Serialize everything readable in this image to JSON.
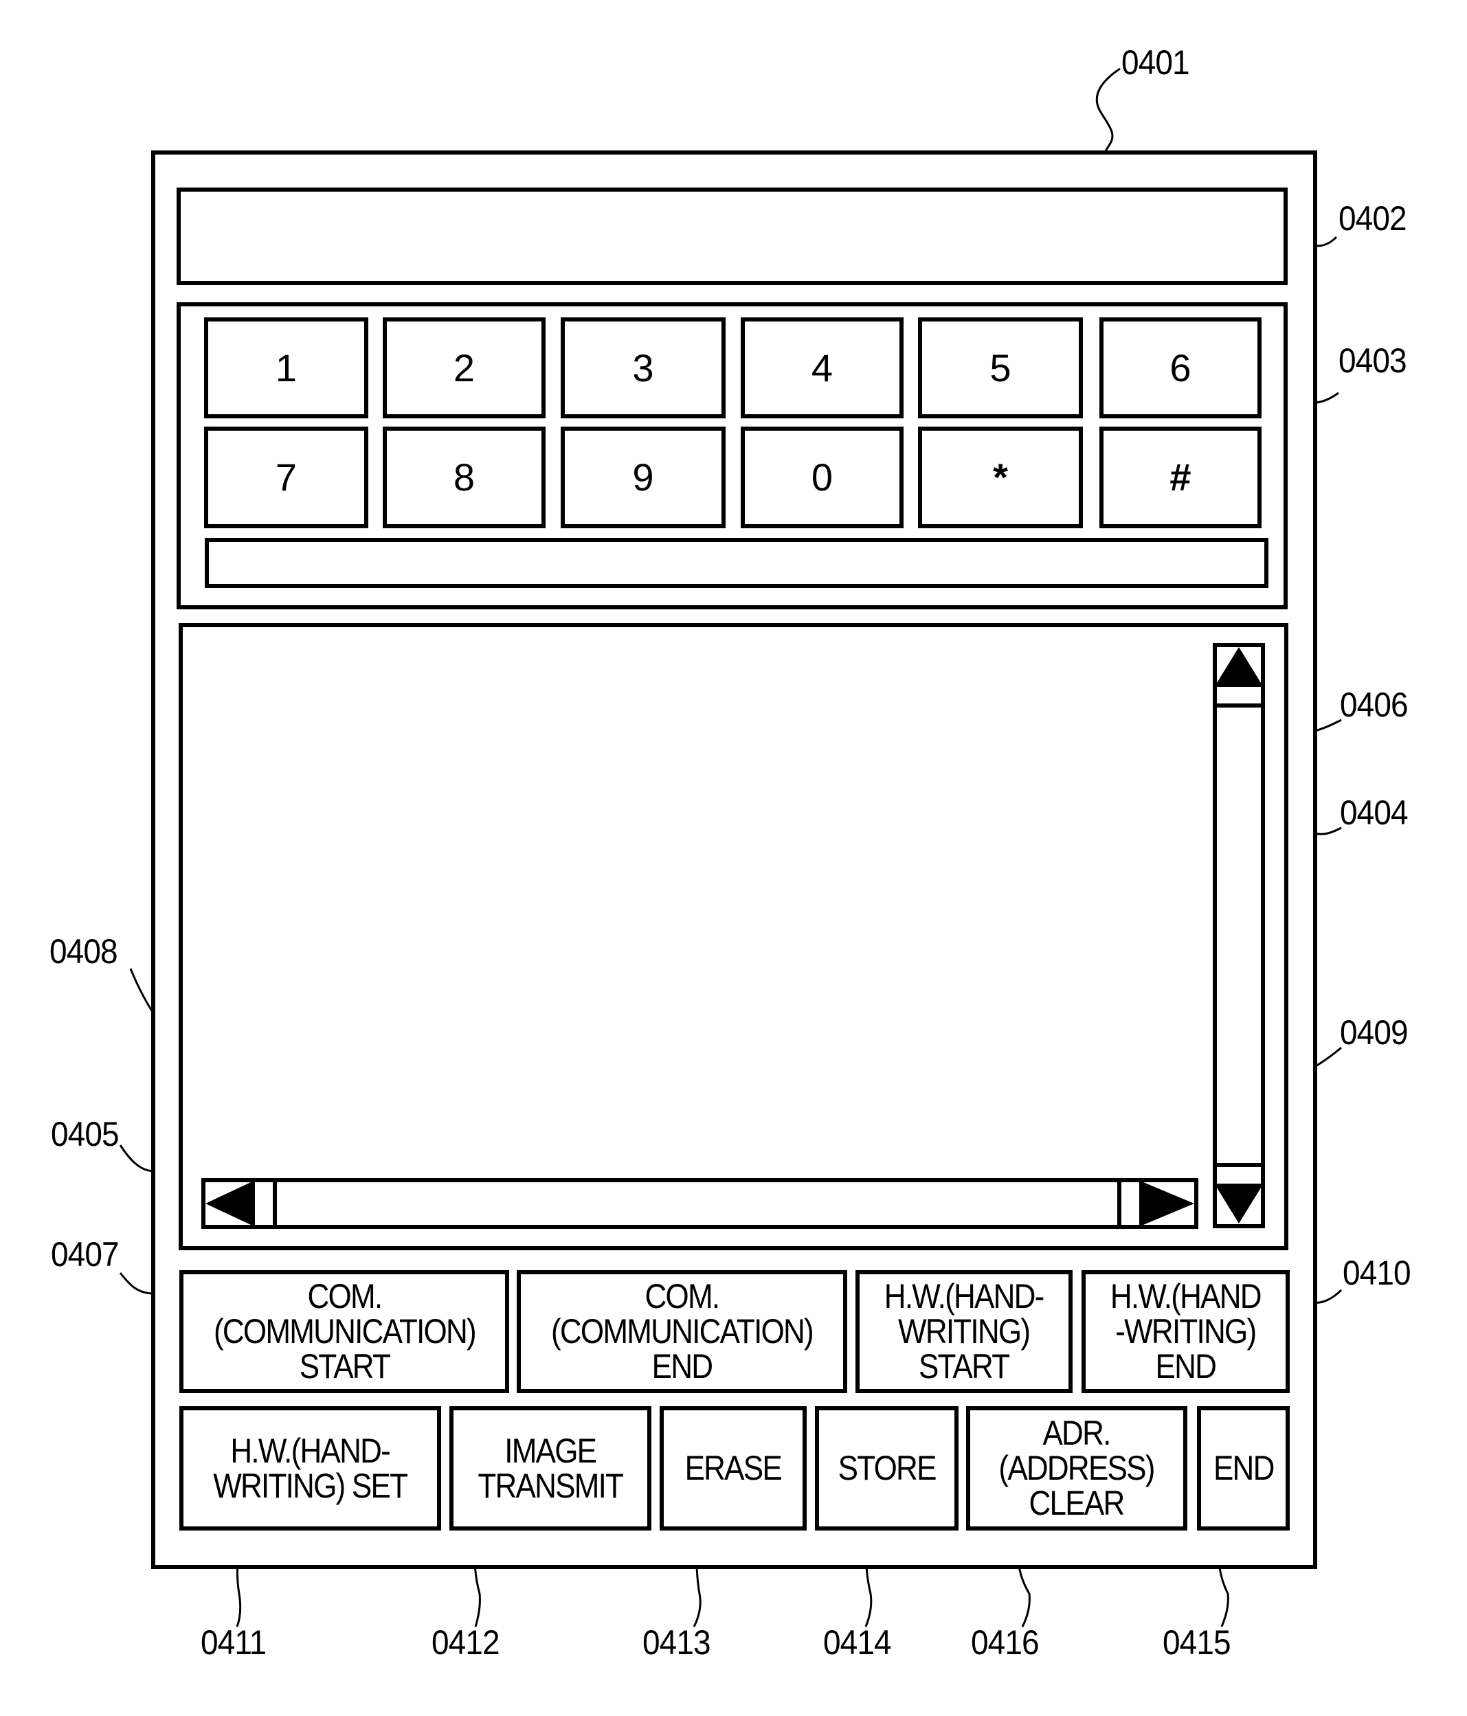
{
  "figure": {
    "device_ref": "0401",
    "display_ref": "0402",
    "keypad_ref": "0403",
    "canvas_ref": "0404",
    "hscroll_ref": "0405",
    "vscroll_ref": "0406"
  },
  "keypad": {
    "row1": [
      "1",
      "2",
      "3",
      "4",
      "5",
      "6"
    ],
    "row2": [
      "7",
      "8",
      "9",
      "0",
      "*",
      "#"
    ],
    "entry_value": ""
  },
  "display": {
    "value": ""
  },
  "buttons_row1": [
    {
      "label": "COM.\n(COMMUNICATION)\nSTART",
      "ref": "0407"
    },
    {
      "label": "COM.\n(COMMUNICATION)\nEND",
      "ref": "0408"
    },
    {
      "label": "H.W.(HAND-\nWRITING)\nSTART",
      "ref": "0409"
    },
    {
      "label": "H.W.(HAND\n-WRITING)\nEND",
      "ref": "0410"
    }
  ],
  "buttons_row2": [
    {
      "label": "H.W.(HAND-\nWRITING) SET",
      "ref": "0411"
    },
    {
      "label": "IMAGE\nTRANSMIT",
      "ref": "0412"
    },
    {
      "label": "ERASE",
      "ref": "0413"
    },
    {
      "label": "STORE",
      "ref": "0414"
    },
    {
      "label": "ADR.\n(ADDRESS)\nCLEAR",
      "ref": "0416"
    },
    {
      "label": "END",
      "ref": "0415"
    }
  ],
  "refs": {
    "r0401": "0401",
    "r0402": "0402",
    "r0403": "0403",
    "r0404": "0404",
    "r0405": "0405",
    "r0406": "0406",
    "r0407": "0407",
    "r0408": "0408",
    "r0409": "0409",
    "r0410": "0410",
    "r0411": "0411",
    "r0412": "0412",
    "r0413": "0413",
    "r0414": "0414",
    "r0416": "0416",
    "r0415": "0415"
  }
}
